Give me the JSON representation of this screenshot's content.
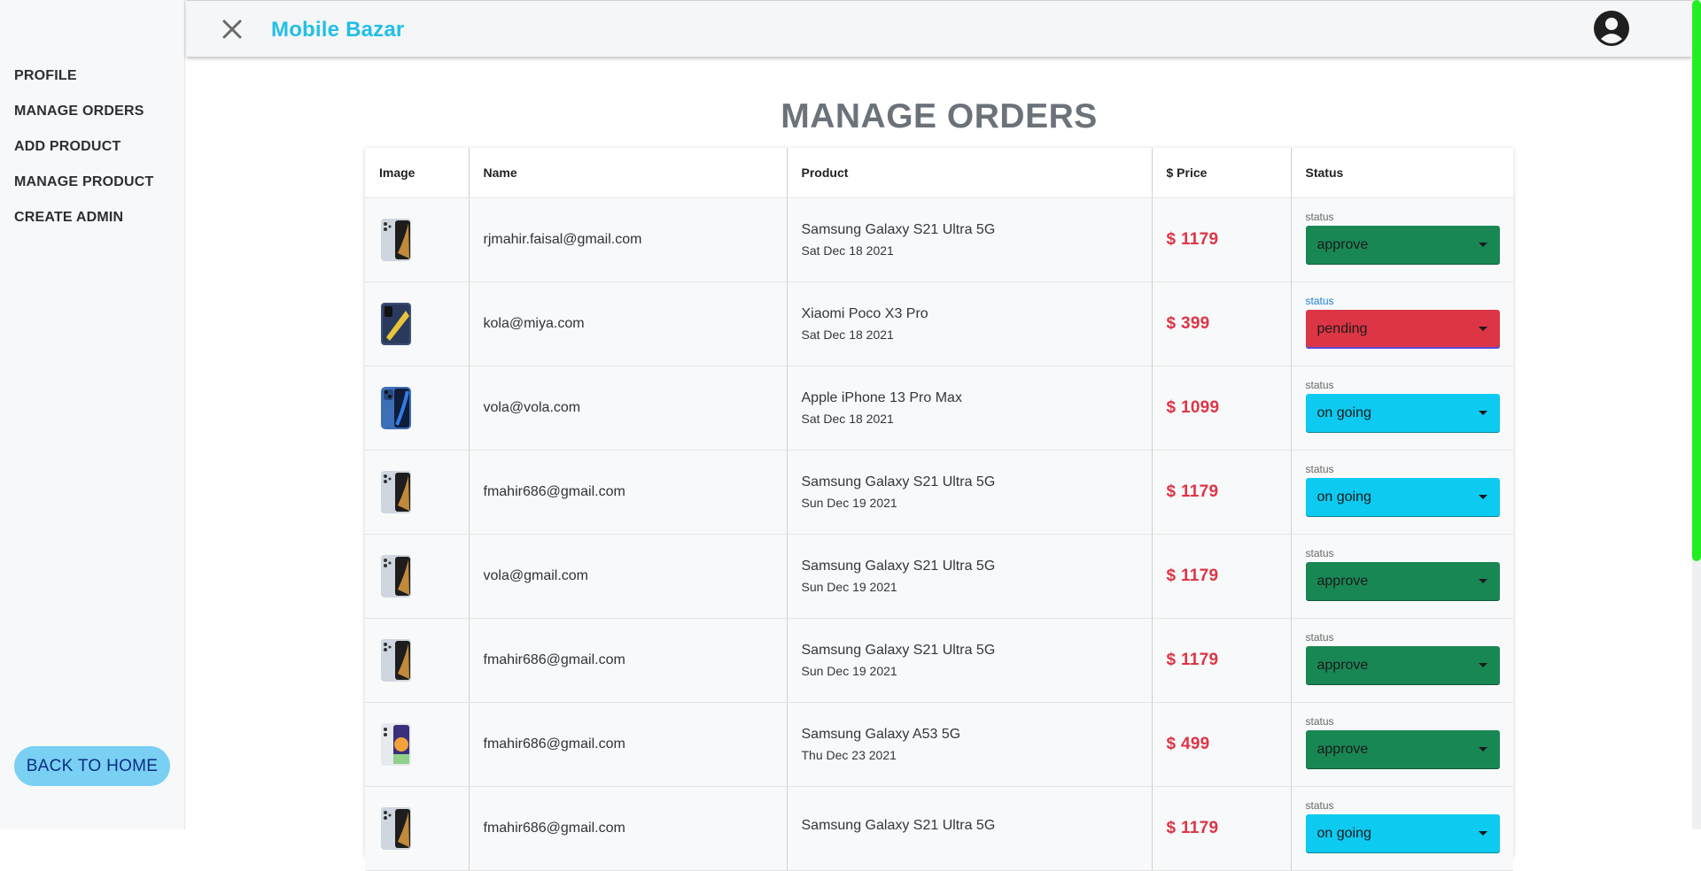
{
  "app": {
    "title": "Mobile Bazar"
  },
  "sidebar": {
    "items": [
      {
        "label": "PROFILE"
      },
      {
        "label": "MANAGE ORDERS"
      },
      {
        "label": "ADD PRODUCT"
      },
      {
        "label": "MANAGE PRODUCT"
      },
      {
        "label": "CREATE ADMIN"
      }
    ],
    "back_button": "BACK TO HOME"
  },
  "page": {
    "title": "MANAGE ORDERS"
  },
  "table": {
    "columns": [
      "Image",
      "Name",
      "Product",
      "$ Price",
      "Status"
    ],
    "status_label": "status",
    "rows": [
      {
        "email": "rjmahir.faisal@gmail.com",
        "product": "Samsung Galaxy S21 Ultra 5G",
        "date": "Sat Dec 18 2021",
        "price": "$ 1179",
        "status": "approve",
        "thumb": "s21-ultra"
      },
      {
        "email": "kola@miya.com",
        "product": "Xiaomi Poco X3 Pro",
        "date": "Sat Dec 18 2021",
        "price": "$ 399",
        "status": "pending",
        "thumb": "poco-x3"
      },
      {
        "email": "vola@vola.com",
        "product": "Apple iPhone 13 Pro Max",
        "date": "Sat Dec 18 2021",
        "price": "$ 1099",
        "status": "on going",
        "thumb": "iphone-13"
      },
      {
        "email": "fmahir686@gmail.com",
        "product": "Samsung Galaxy S21 Ultra 5G",
        "date": "Sun Dec 19 2021",
        "price": "$ 1179",
        "status": "on going",
        "thumb": "s21-ultra"
      },
      {
        "email": "vola@gmail.com",
        "product": "Samsung Galaxy S21 Ultra 5G",
        "date": "Sun Dec 19 2021",
        "price": "$ 1179",
        "status": "approve",
        "thumb": "s21-ultra"
      },
      {
        "email": "fmahir686@gmail.com",
        "product": "Samsung Galaxy S21 Ultra 5G",
        "date": "Sun Dec 19 2021",
        "price": "$ 1179",
        "status": "approve",
        "thumb": "s21-ultra"
      },
      {
        "email": "fmahir686@gmail.com",
        "product": "Samsung Galaxy A53 5G",
        "date": "Thu Dec 23 2021",
        "price": "$ 499",
        "status": "approve",
        "thumb": "a53"
      },
      {
        "email": "fmahir686@gmail.com",
        "product": "Samsung Galaxy S21 Ultra 5G",
        "date": "",
        "price": "$ 1179",
        "status": "on going",
        "thumb": "s21-ultra"
      }
    ]
  },
  "colors": {
    "accent": "#22bfe6",
    "approve": "#198754",
    "pending": "#dc3545",
    "ongoing": "#0dcaf0",
    "price": "#dc3545",
    "scroll": "#22ee22"
  }
}
